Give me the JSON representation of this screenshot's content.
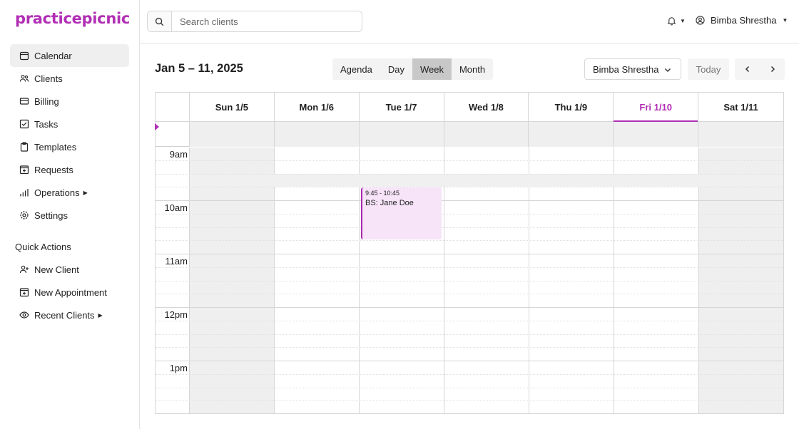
{
  "brand": "practicepicnic",
  "sidebar": {
    "items": [
      {
        "label": "Calendar",
        "icon": "calendar-icon"
      },
      {
        "label": "Clients",
        "icon": "users-icon"
      },
      {
        "label": "Billing",
        "icon": "credit-card-icon"
      },
      {
        "label": "Tasks",
        "icon": "checkbox-icon"
      },
      {
        "label": "Templates",
        "icon": "clipboard-icon"
      },
      {
        "label": "Requests",
        "icon": "calendar-plus-icon"
      },
      {
        "label": "Operations",
        "icon": "bar-chart-icon"
      },
      {
        "label": "Settings",
        "icon": "gear-icon"
      }
    ],
    "quick_actions_title": "Quick Actions",
    "quick_actions": [
      {
        "label": "New Client",
        "icon": "user-plus-icon"
      },
      {
        "label": "New Appointment",
        "icon": "calendar-plus-icon"
      },
      {
        "label": "Recent Clients",
        "icon": "eye-icon"
      }
    ]
  },
  "header": {
    "search_placeholder": "Search clients",
    "user_name": "Bimba Shrestha"
  },
  "toolbar": {
    "range_title": "Jan 5 – 11, 2025",
    "views": [
      "Agenda",
      "Day",
      "Week",
      "Month"
    ],
    "active_view": "Week",
    "member_select": "Bimba Shrestha",
    "today_label": "Today"
  },
  "calendar": {
    "days": [
      "Sun 1/5",
      "Mon 1/6",
      "Tue 1/7",
      "Wed 1/8",
      "Thu 1/9",
      "Fri 1/10",
      "Sat 1/11"
    ],
    "today": "Fri 1/10",
    "hours": [
      "9am",
      "10am",
      "11am",
      "12pm",
      "1pm"
    ],
    "event": {
      "time": "9:45 - 10:45",
      "title": "BS: Jane Doe",
      "day": "Tue 1/7"
    }
  },
  "colors": {
    "brand": "#b12fb5",
    "event_bg": "#f7e4f9",
    "event_border": "#a62aab"
  }
}
